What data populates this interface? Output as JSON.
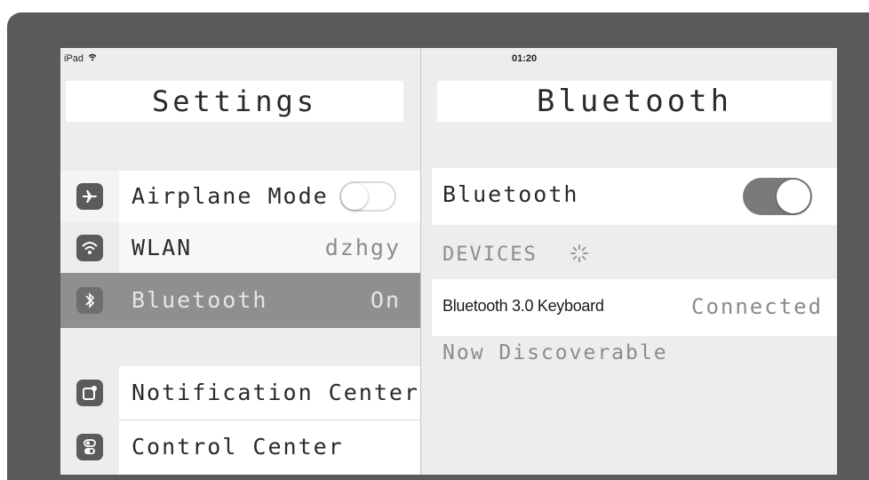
{
  "status_bar": {
    "device": "iPad",
    "time": "01:20"
  },
  "left_panel": {
    "title": "Settings",
    "rows": [
      {
        "label": "Airplane Mode",
        "icon": "airplane-icon",
        "toggle": "off"
      },
      {
        "label": "WLAN",
        "value": "dzhgy",
        "icon": "wifi-icon"
      },
      {
        "label": "Bluetooth",
        "value": "On",
        "icon": "bluetooth-icon",
        "selected": true
      },
      {
        "label": "Notification Center",
        "icon": "notification-center-icon"
      },
      {
        "label": "Control Center",
        "icon": "control-center-icon"
      }
    ]
  },
  "right_panel": {
    "title": "Bluetooth",
    "bluetooth_toggle": {
      "label": "Bluetooth",
      "state": "on"
    },
    "devices_header": "DEVICES",
    "devices": [
      {
        "name": "Bluetooth 3.0 Keyboard",
        "status": "Connected"
      }
    ],
    "footer": "Now Discoverable"
  },
  "colors": {
    "frame": "#5a5a5a",
    "selected_row": "#8f8f8f",
    "toggle_on": "#7a7a7a"
  }
}
